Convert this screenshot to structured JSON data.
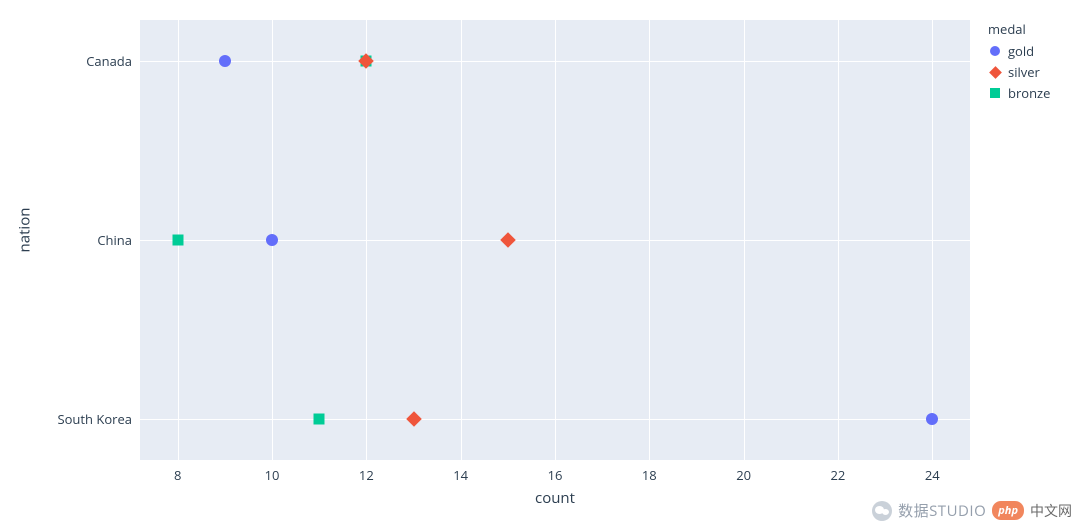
{
  "chart_data": {
    "type": "scatter",
    "xlabel": "count",
    "ylabel": "nation",
    "x_ticks": [
      8,
      10,
      12,
      14,
      16,
      18,
      20,
      22,
      24
    ],
    "categories": [
      "Canada",
      "China",
      "South Korea"
    ],
    "legend_title": "medal",
    "series": [
      {
        "name": "gold",
        "symbol": "circle",
        "color": "#636efa",
        "values": [
          9,
          10,
          24
        ]
      },
      {
        "name": "silver",
        "symbol": "diamond",
        "color": "#ef553b",
        "values": [
          12,
          15,
          13
        ]
      },
      {
        "name": "bronze",
        "symbol": "square",
        "color": "#00cc96",
        "values": [
          12,
          8,
          11
        ]
      }
    ],
    "xlim": [
      7.2,
      24.8
    ]
  },
  "legend": {
    "title": "medal",
    "items": [
      {
        "label": "gold"
      },
      {
        "label": "silver"
      },
      {
        "label": "bronze"
      }
    ]
  },
  "axes": {
    "x_title": "count",
    "y_title": "nation",
    "y_ticks": [
      "Canada",
      "China",
      "South Korea"
    ],
    "x_ticks": [
      "8",
      "10",
      "12",
      "14",
      "16",
      "18",
      "20",
      "22",
      "24"
    ]
  },
  "watermark": {
    "studio_text": "数据STUDIO",
    "php_text": "php",
    "cn_text": "中文网"
  }
}
